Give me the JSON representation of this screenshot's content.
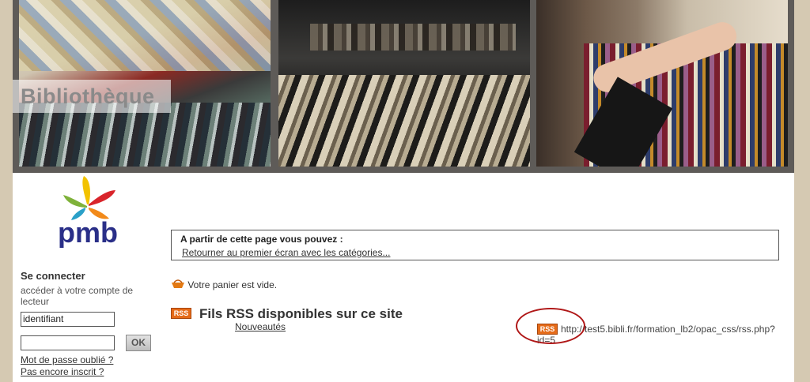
{
  "header": {
    "title": "Bibliothèque"
  },
  "logo": {
    "text": "pmb"
  },
  "login": {
    "title": "Se connecter",
    "subtitle": "accéder à votre compte de lecteur",
    "username_value": "identifiant",
    "password_value": "",
    "ok_label": "OK",
    "forgot_link": "Mot de passe oublié ?",
    "register_link": "Pas encore inscrit ?"
  },
  "info": {
    "heading": "A partir de cette page vous pouvez :",
    "link": "Retourner au premier écran avec les catégories..."
  },
  "basket": {
    "text": "Votre panier est vide."
  },
  "rss": {
    "badge": "RSS",
    "title": "Fils RSS disponibles sur ce site",
    "feed_name": "Nouveautés",
    "feed_url": "http://test5.bibli.fr/formation_lb2/opac_css/rss.php?id=5"
  },
  "colors": {
    "rss_orange": "#e56b19",
    "annotation_red": "#b01818",
    "page_bg": "#d5c9b2"
  }
}
